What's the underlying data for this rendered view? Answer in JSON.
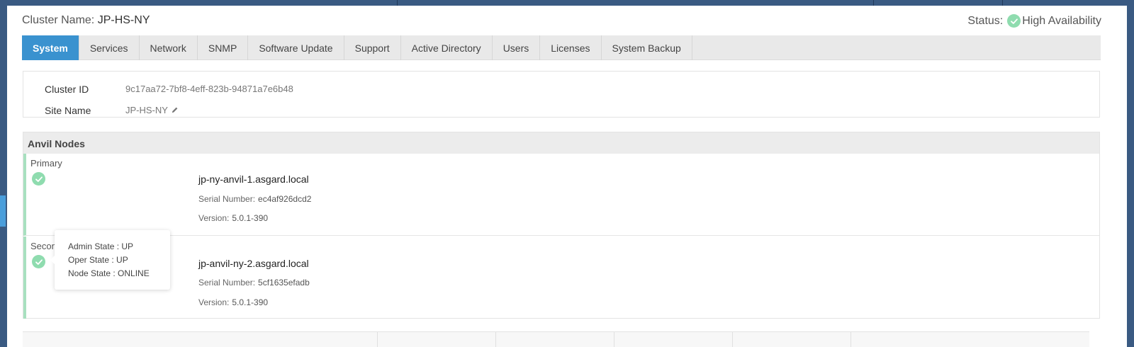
{
  "header": {
    "cluster_label": "Cluster Name:",
    "cluster_name": "JP-HS-NY",
    "status_label": "Status:",
    "status_value": "High Availability"
  },
  "tabs": [
    {
      "label": "System",
      "active": true
    },
    {
      "label": "Services"
    },
    {
      "label": "Network"
    },
    {
      "label": "SNMP"
    },
    {
      "label": "Software Update"
    },
    {
      "label": "Support"
    },
    {
      "label": "Active Directory"
    },
    {
      "label": "Users"
    },
    {
      "label": "Licenses"
    },
    {
      "label": "System Backup"
    }
  ],
  "info": {
    "cluster_id_label": "Cluster ID",
    "cluster_id": "9c17aa72-7bf8-4eff-823b-94871a7e6b48",
    "site_name_label": "Site Name",
    "site_name": "JP-HS-NY"
  },
  "nodes": {
    "title": "Anvil Nodes",
    "primary": {
      "role": "Primary",
      "hostname": "jp-ny-anvil-1.asgard.local",
      "serial_label": "Serial Number:",
      "serial": "ec4af926dcd2",
      "version_label": "Version:",
      "version": "5.0.1-390"
    },
    "secondary": {
      "role": "Secon",
      "hostname": "jp-anvil-ny-2.asgard.local",
      "serial_label": "Serial Number:",
      "serial": "5cf1635efadb",
      "version_label": "Version:",
      "version": "5.0.1-390"
    }
  },
  "tooltip": {
    "admin_state": "Admin State : UP",
    "oper_state": "Oper State : UP",
    "node_state": "Node State : ONLINE"
  },
  "colors": {
    "accent": "#3a92cf",
    "ok_green": "#8fdcaf",
    "node_bar": "#a8e0bf"
  }
}
